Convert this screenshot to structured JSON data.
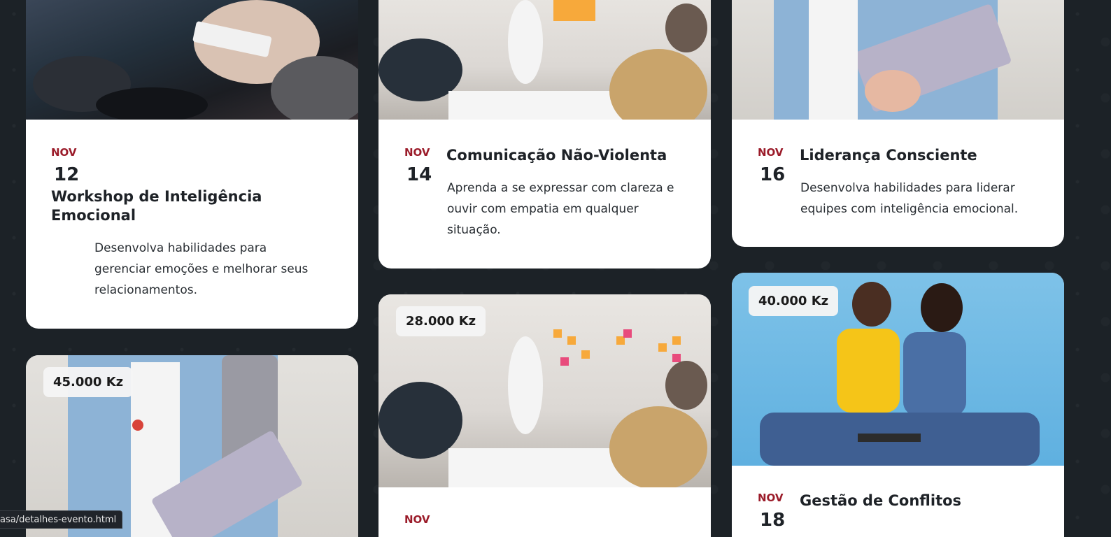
{
  "cards": [
    {
      "month": "NOV",
      "day": "12",
      "title": "Workshop de Inteligência Emocional",
      "description": "Desenvolva habilidades para gerenciar emoções e melhorar seus relacionamentos."
    },
    {
      "month": "NOV",
      "day": "14",
      "title": "Comunicação Não-Violenta",
      "description": "Aprenda a se expressar com clareza e ouvir com empatia em qualquer situação."
    },
    {
      "month": "NOV",
      "day": "16",
      "title": "Liderança Consciente",
      "description": "Desenvolva habilidades para liderar equipes com inteligência emocional."
    },
    {
      "price": "45.000 Kz"
    },
    {
      "price": "28.000 Kz",
      "month": "NOV"
    },
    {
      "price": "40.000 Kz",
      "month": "NOV",
      "day": "18",
      "title": "Gestão de Conflitos"
    }
  ],
  "status_bar": {
    "url": "asa/detalhes-evento.html"
  },
  "colors": {
    "background": "#1c2227",
    "card": "#ffffff",
    "month_accent": "#9b1c2a",
    "text_dark": "#1e2227"
  }
}
